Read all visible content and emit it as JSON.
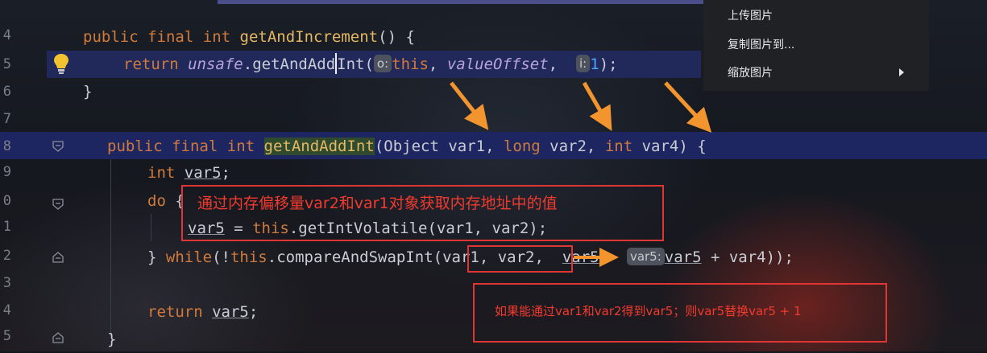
{
  "line_numbers": [
    "4",
    "5",
    "6",
    "7",
    "8",
    "9",
    "0",
    "1",
    "2",
    "3",
    "4",
    "5"
  ],
  "context_menu": {
    "items": [
      {
        "label": "上传图片"
      },
      {
        "label": "复制图片到..."
      },
      {
        "label": "缩放图片"
      }
    ]
  },
  "code": {
    "l1": {
      "kw1": "public",
      "kw2": "final",
      "kw3": "int",
      "fn": "getAndIncrement",
      "rest": "() {"
    },
    "l2": {
      "kw": "return",
      "obj": "unsafe",
      "dot": ".",
      "fn1": "getAndAdd",
      "fn2": "Int",
      "paren": "(",
      "hint_o": "o:",
      "this": "this",
      "comma1": ", ",
      "field": "valueOffset",
      "comma2": ",",
      "hint_i": "i:",
      "num": "1",
      "end": ");"
    },
    "l3": {
      "text": "}"
    },
    "l5": {
      "kw1": "public",
      "kw2": "final",
      "kw3": "int",
      "fn": "getAndAddInt",
      "p1": "(Object var1, ",
      "kwlong": "long",
      "p2": " var2, ",
      "kwint": "int",
      "p3": " var4) {"
    },
    "l6": {
      "kw": "int",
      "var": "var5",
      "semi": ";"
    },
    "l7": {
      "kw": "do",
      "brace": " {"
    },
    "l8": {
      "var": "var5",
      "eq": " = ",
      "this": "this",
      "call": ".getIntVolatile(var1, var2);"
    },
    "l9": {
      "brace": "} ",
      "kw": "while",
      "p1": "(!",
      "this": "this",
      "call": ".compareAndSwapInt(",
      "args": "var1, var2",
      "comma": ",",
      "arg3": "var5",
      "comma2": ",",
      "hint": "var5:",
      "arg4": "var5",
      "tail": " + var4));"
    },
    "l11": {
      "kw": "return",
      "var": "var5",
      "semi": ";"
    },
    "l12": {
      "text": "}"
    }
  },
  "annotations": {
    "note1": "通过内存偏移量var2和var1对象获取内存地址中的值",
    "note2": "如果能通过var1和var2得到var5；则var5替换var5 + 1"
  },
  "colors": {
    "arrow": "#f2952e",
    "redbox": "#e03535",
    "note": "#f23a2e"
  }
}
